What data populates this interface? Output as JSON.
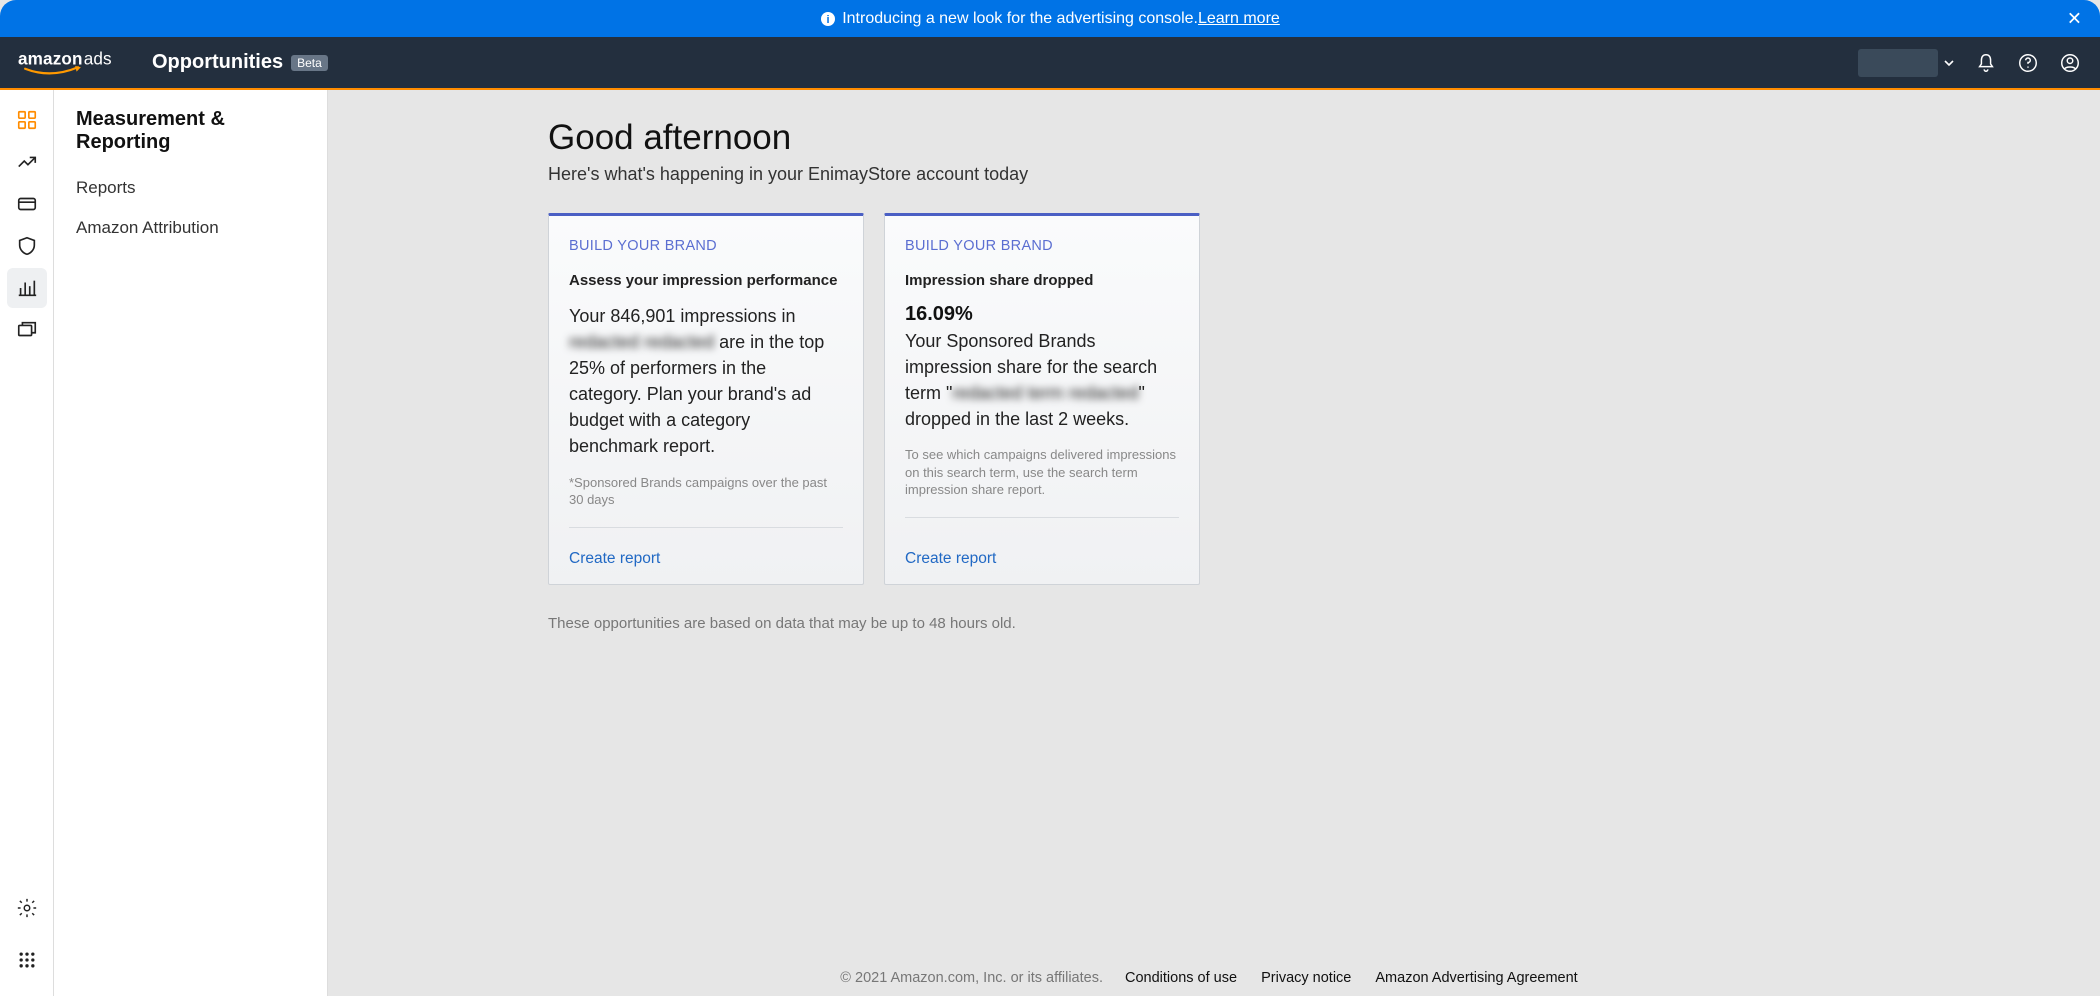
{
  "banner": {
    "text": "Introducing a new look for the advertising console. ",
    "link": "Learn more"
  },
  "topnav": {
    "brand_main": "amazon",
    "brand_sub": "ads",
    "section": "Opportunities",
    "badge": "Beta"
  },
  "sidebar": {
    "header": "Measurement & Reporting",
    "items": [
      {
        "label": "Reports"
      },
      {
        "label": "Amazon Attribution"
      }
    ]
  },
  "main": {
    "greeting": "Good afternoon",
    "subgreeting": "Here's what's happening in your EnimayStore account today",
    "cards": [
      {
        "eyebrow": "BUILD YOUR BRAND",
        "title": "Assess your impression performance",
        "body_prefix": "Your 846,901 impressions in ",
        "body_blur1": "redacted",
        "body_mid": " ",
        "body_blur2": "redacted",
        "body_suffix": " are in the top 25% of performers in the category. Plan your brand's ad budget with a category benchmark report.",
        "foot": "*Sponsored Brands campaigns over the past 30 days",
        "link": "Create report"
      },
      {
        "eyebrow": "BUILD YOUR BRAND",
        "title": "Impression share dropped",
        "bignum": "16.09%",
        "body_prefix": "Your Sponsored Brands impression share for the search term \"",
        "body_blur1": "redacted term",
        "body_mid": " ",
        "body_blur2": "redacted",
        "body_suffix": "\" dropped in the last 2 weeks.",
        "foot": "To see which campaigns delivered impressions on this search term, use the search term impression share report.",
        "link": "Create report"
      }
    ],
    "note": "These opportunities are based on data that may be up to 48 hours old."
  },
  "footer": {
    "copy": "© 2021 Amazon.com, Inc. or its affiliates.",
    "links": [
      "Conditions of use",
      "Privacy notice",
      "Amazon Advertising Agreement"
    ]
  }
}
